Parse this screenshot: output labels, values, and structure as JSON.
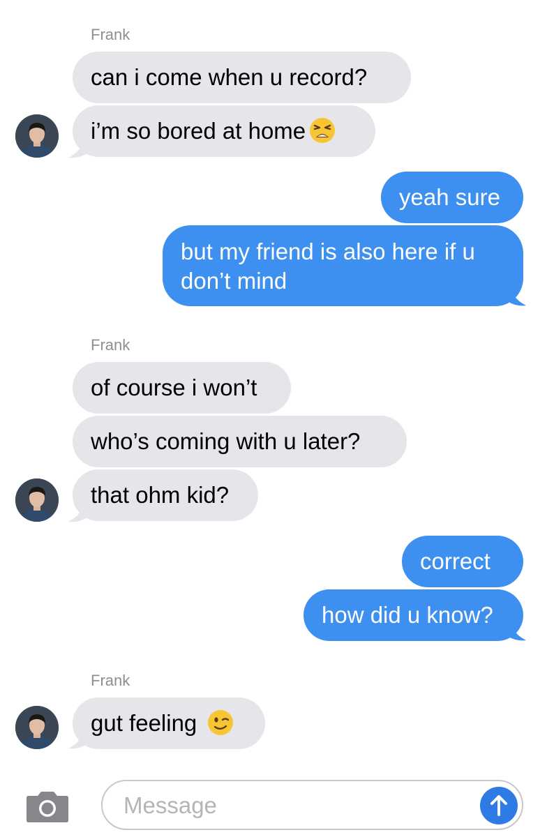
{
  "conversation": {
    "groups": [
      {
        "sender": "Frank",
        "messages": [
          "can i come when u record?",
          "i’m so bored at home"
        ]
      },
      {
        "outgoing": [
          "yeah sure",
          "but my friend is also here if u don’t mind"
        ]
      },
      {
        "sender": "Frank",
        "messages": [
          "of course i won’t",
          "who’s coming with u later?",
          "that ohm kid?"
        ]
      },
      {
        "outgoing": [
          "correct",
          "how did u know?"
        ]
      },
      {
        "sender": "Frank",
        "messages": [
          "gut feeling"
        ]
      }
    ]
  },
  "compose": {
    "placeholder": "Message"
  },
  "icons": {
    "camera": "camera-icon",
    "send": "arrow-up-icon",
    "tired_face": "tired-face-emoji",
    "winking_face": "winking-face-emoji"
  },
  "colors": {
    "incoming_bubble": "#e5e5ea",
    "outgoing_bubble": "#3d8ff0",
    "send_button": "#2f7be5"
  }
}
